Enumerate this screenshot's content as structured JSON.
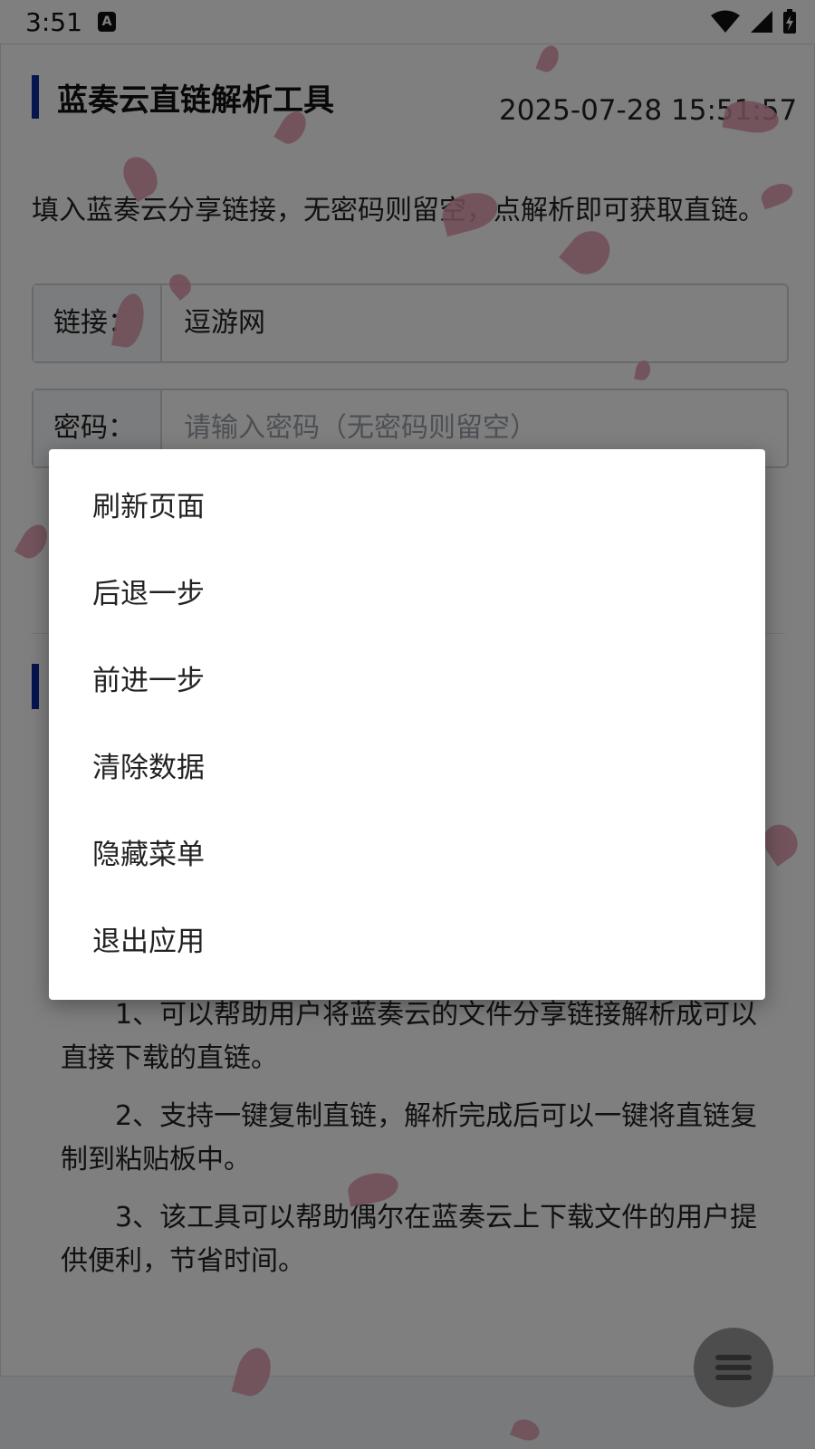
{
  "status_bar": {
    "time": "3:51",
    "notification_icon": "A",
    "icons": [
      "wifi-icon",
      "signal-icon",
      "battery-charging-icon"
    ]
  },
  "page": {
    "title": "蓝奏云直链解析工具",
    "datetime": "2025-07-28 15:51:57",
    "description": "填入蓝奏云分享链接，无密码则留空，点解析即可获取直链。",
    "link_field": {
      "label": "链接：",
      "value": "逗游网"
    },
    "password_field": {
      "label": "密码：",
      "placeholder": "请输入密码（无密码则留空）"
    },
    "info_paragraphs": [
      "1、可以帮助用户将蓝奏云的文件分享链接解析成可以直接下载的直链。",
      "2、支持一键复制直链，解析完成后可以一键将直链复制到粘贴板中。",
      "3、该工具可以帮助偶尔在蓝奏云上下载文件的用户提供便利，节省时间。"
    ]
  },
  "menu": {
    "items": [
      "刷新页面",
      "后退一步",
      "前进一步",
      "清除数据",
      "隐藏菜单",
      "退出应用"
    ]
  },
  "colors": {
    "accent": "#0a2a9a",
    "petal": "#e29aae",
    "scrim": "rgba(0,0,0,0.5)"
  }
}
